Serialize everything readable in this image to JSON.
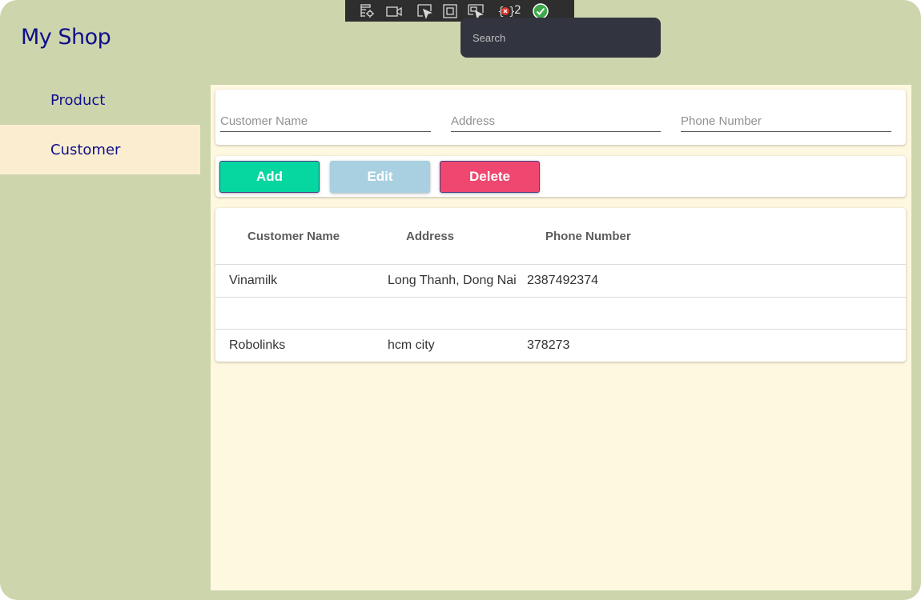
{
  "app": {
    "title": "My Shop"
  },
  "sidebar": {
    "items": [
      {
        "label": "Product",
        "active": false
      },
      {
        "label": "Customer",
        "active": true
      }
    ]
  },
  "form": {
    "customer_name_placeholder": "Customer Name",
    "address_placeholder": "Address",
    "phone_placeholder": "Phone Number"
  },
  "actions": {
    "add_label": "Add",
    "edit_label": "Edit",
    "delete_label": "Delete",
    "edit_enabled": false
  },
  "table": {
    "headers": [
      "Customer Name",
      "Address",
      "Phone Number"
    ],
    "rows": [
      [
        "Vinamilk",
        "Long Thanh, Dong Nai",
        "2387492374"
      ],
      [
        "",
        "",
        ""
      ],
      [
        "Robolinks",
        "hcm city",
        "378273"
      ]
    ]
  },
  "debug_toolbar": {
    "icons": [
      "live-visual-tree-icon",
      "record-icon",
      "select-element-icon",
      "display-layout-adorners-icon",
      "track-focused-element-icon",
      "binding-failures-icon",
      "hot-reload-ok-icon"
    ],
    "binding_failures_count": "2",
    "search_placeholder": "Search"
  },
  "colors": {
    "window_bg": "#cdd5ad",
    "content_bg": "#fff8e0",
    "nav_active_bg": "#fbeed0",
    "title_color": "#0f0f8c",
    "add_button": "#06d6a0",
    "edit_button": "#a8d0e0",
    "delete_button": "#ef476f"
  }
}
